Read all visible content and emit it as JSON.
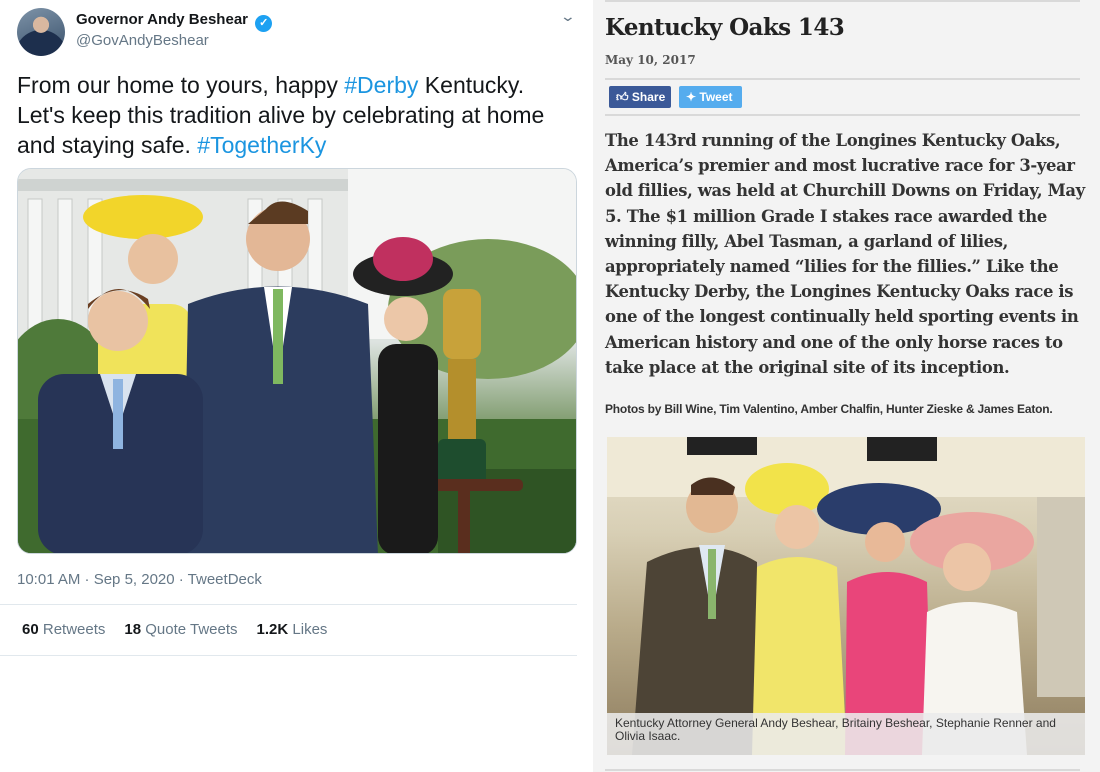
{
  "tweet": {
    "author_name": "Governor Andy Beshear",
    "verified_mark": "✓",
    "handle": "@GovAndyBeshear",
    "menu_icon": "chevron-down-icon",
    "text_parts": {
      "p1": "From our home to yours, happy ",
      "tag1": "#Derby",
      "p2": " Kentucky. Let's keep this tradition alive by celebrating at home and staying safe. ",
      "tag2": "#TogetherKy"
    },
    "timestamp": "10:01 AM · Sep 5, 2020 · TweetDeck",
    "stats": {
      "retweets_count": "60",
      "retweets_label": "Retweets",
      "quotes_count": "18",
      "quotes_label": "Quote Tweets",
      "likes_count": "1.2K",
      "likes_label": "Likes"
    },
    "link_color": "#1b95e0"
  },
  "article": {
    "title": "Kentucky Oaks 143",
    "date": "May 10, 2017",
    "share_icon": "thumbs-up-icon",
    "share_label": "Share",
    "tweet_icon": "twitter-bird-icon",
    "tweet_label": "Tweet",
    "body": "The 143rd running of the Longines Kentucky Oaks, America’s premier and most lucrative race for 3-year old fillies, was held at Churchill Downs on Friday, May 5. The $1 million Grade I stakes race awarded the winning filly, Abel Tasman, a garland of lilies, appropriately named “lilies for the fillies.” Like the Kentucky Derby, the Longines Kentucky Oaks race is one of the longest continually held sporting events in American history and one of the only horse races to take place at the original site of its inception.",
    "photo_credit": "Photos by Bill Wine, Tim Valentino, Amber Chalfin, Hunter Zieske & James Eaton.",
    "photo_caption": "Kentucky Attorney General Andy Beshear, Britainy Beshear, Stephanie Renner and Olivia Isaac.",
    "facebook_color": "#3b5998",
    "twitter_color": "#55acee"
  }
}
